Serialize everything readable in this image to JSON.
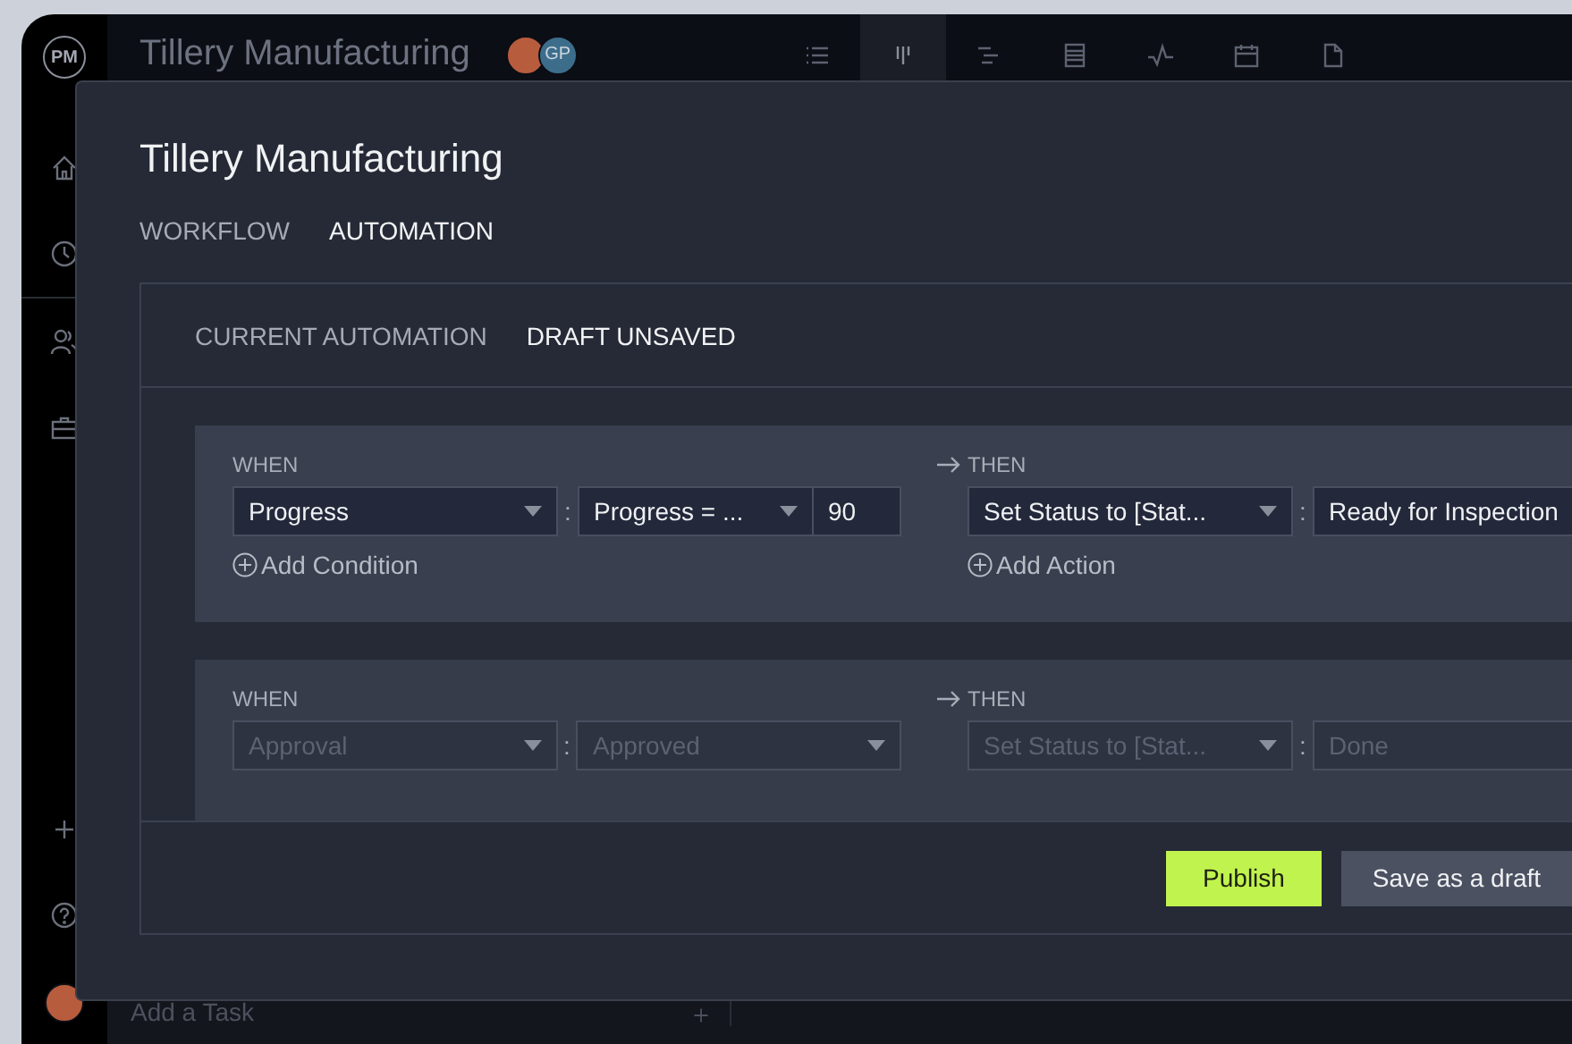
{
  "app": {
    "logo": "PM",
    "title": "Tillery Manufacturing",
    "avatars": [
      {
        "kind": "photo"
      },
      {
        "kind": "initials",
        "initials": "GP"
      }
    ],
    "views": [
      {
        "kind": "list",
        "selected": false
      },
      {
        "kind": "board",
        "selected": true
      },
      {
        "kind": "gantt",
        "selected": false
      },
      {
        "kind": "sheet",
        "selected": false
      },
      {
        "kind": "dashboard",
        "selected": false
      },
      {
        "kind": "calendar",
        "selected": false
      },
      {
        "kind": "files",
        "selected": false
      }
    ],
    "sidebar_top": [
      {
        "kind": "home"
      },
      {
        "kind": "clock"
      },
      {
        "kind": "people"
      },
      {
        "kind": "briefcase"
      }
    ],
    "sidebar_bottom": [
      {
        "kind": "plus"
      },
      {
        "kind": "help"
      },
      {
        "kind": "avatar"
      }
    ],
    "add_task": "Add a Task"
  },
  "modal": {
    "title": "Tillery Manufacturing",
    "tabs": [
      {
        "label": "WORKFLOW",
        "selected": false
      },
      {
        "label": "AUTOMATION",
        "selected": true
      }
    ],
    "subtabs": [
      {
        "label": "CURRENT AUTOMATION",
        "selected": false
      },
      {
        "label": "DRAFT UNSAVED",
        "selected": true
      }
    ],
    "rules": [
      {
        "faded": false,
        "separator": ":",
        "when_label": "WHEN",
        "conditions": [
          {
            "field": "Progress",
            "operator": "Progress = ...",
            "value": "90"
          }
        ],
        "add_condition": "Add Condition",
        "then_label": "THEN",
        "actions": [
          {
            "action": "Set Status to [Stat...",
            "value": "Ready for Inspection"
          }
        ],
        "add_action": "Add Action"
      },
      {
        "faded": true,
        "separator": ":",
        "when_label": "WHEN",
        "conditions": [
          {
            "field": "Approval",
            "operator": "Approved"
          }
        ],
        "then_label": "THEN",
        "actions": [
          {
            "action": "Set Status to [Stat...",
            "value": "Done"
          }
        ]
      }
    ],
    "buttons": [
      {
        "label": "Publish",
        "kind": "primary"
      },
      {
        "label": "Save as a draft",
        "kind": "secondary"
      }
    ]
  }
}
